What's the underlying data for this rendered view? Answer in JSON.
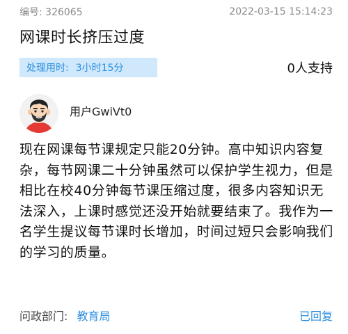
{
  "header": {
    "id_label": "编号:",
    "id_value": "326065",
    "timestamp": "2022-03-15 15:14:23",
    "title": "网课时长挤压过度"
  },
  "stats": {
    "duration_label": "处理用时:",
    "duration_value": "3小时15分",
    "support_text": "0人支持"
  },
  "user": {
    "name": "用户GwiVt0",
    "avatar_icon": "cartoon-boy-avatar-icon"
  },
  "content": {
    "body": "现在网课每节课规定只能20分钟。高中知识内容复杂，每节网课二十分钟虽然可以保护学生视力，但是相比在校40分钟每节课压缩过度，很多内容知识无法深入，上课时感觉还没开始就要结束了。我作为一名学生提议每节课时长增加，时间过短只会影响我们的学习的质量。"
  },
  "footer": {
    "dept_label": "问政部门:",
    "dept_value": "教育局",
    "reply_status": "已回复"
  },
  "colors": {
    "accent_blue": "#2c8fe0",
    "badge_bg": "#cfe8fb",
    "meta_gray": "#8a8a8a"
  }
}
